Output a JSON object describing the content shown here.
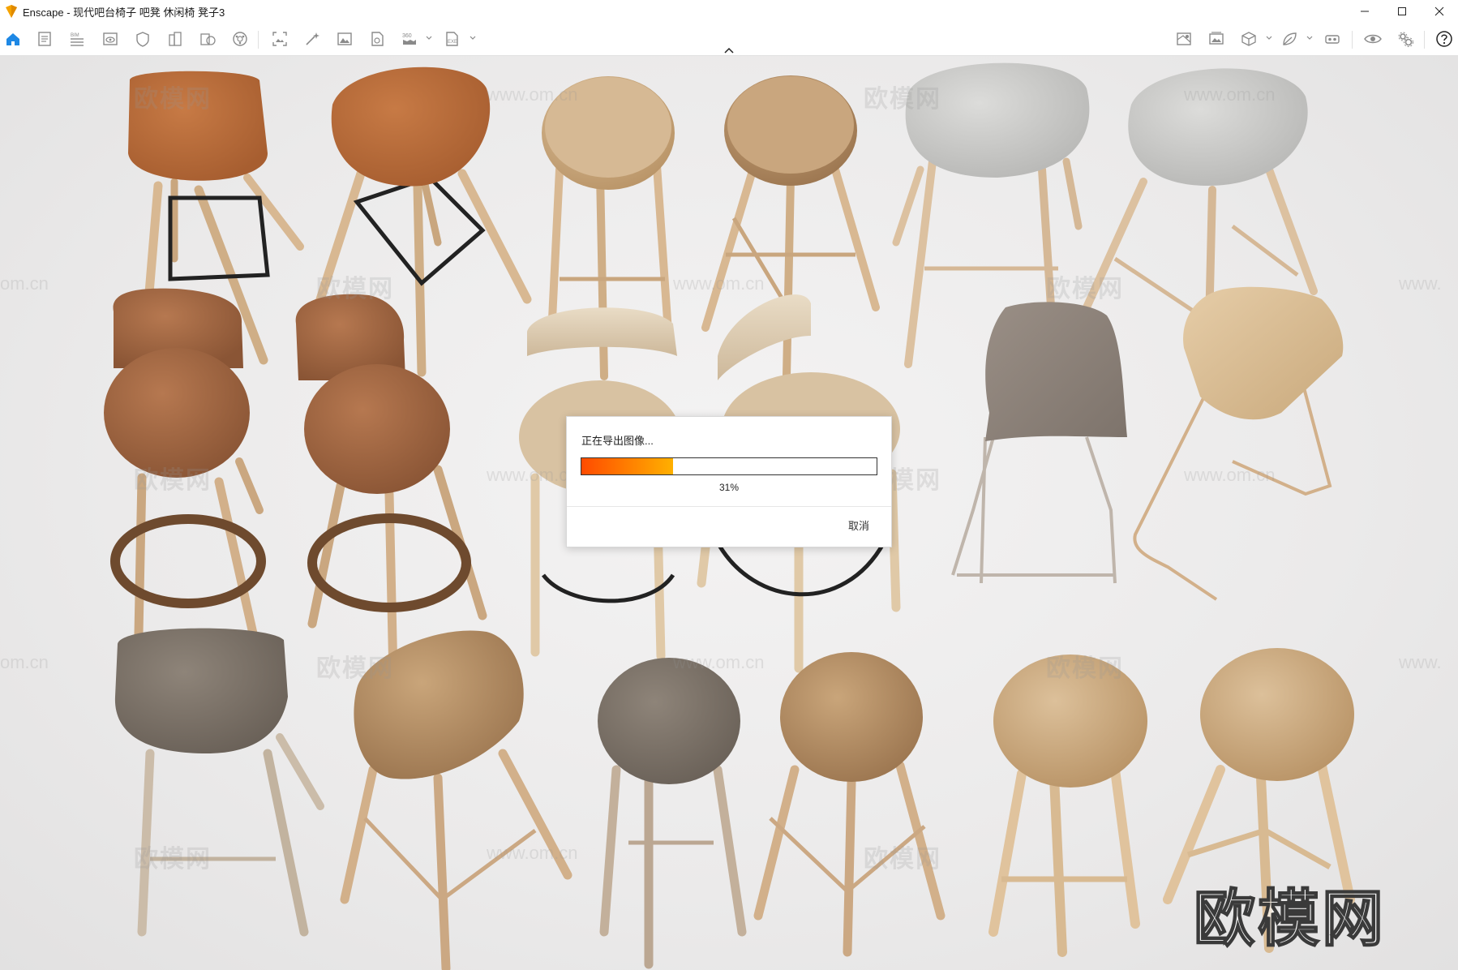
{
  "window": {
    "app_name": "Enscape",
    "title": "Enscape - 现代吧台椅子 吧凳 休闲椅 凳子3",
    "controls": [
      "minimize",
      "maximize",
      "close"
    ]
  },
  "toolbar": {
    "left_icons": [
      "home-icon",
      "notes-icon",
      "bim-icon",
      "visibility-icon",
      "safe-frame-icon",
      "building-icon",
      "asset-library-icon",
      "material-icon",
      "screenshot-icon",
      "sparkle-icon",
      "image-icon",
      "export-file-icon",
      "panorama-icon",
      "exe-export-icon"
    ],
    "right_icons": [
      "map-icon",
      "gallery-icon",
      "cube-icon",
      "leaf-icon",
      "vr-headset-icon",
      "eye-icon",
      "settings-icon",
      "help-icon"
    ]
  },
  "viewport": {
    "watermark_text": "欧模网",
    "watermark_url": "www.om.cn",
    "watermark_fragment_left": "om.cn",
    "watermark_fragment_right": "www."
  },
  "dialog": {
    "title": "正在导出图像...",
    "progress_percent": 31,
    "progress_label": "31%",
    "cancel_label": "取消"
  },
  "colors": {
    "accent": "#1e88e5",
    "progress_start": "#ff4b00",
    "progress_end": "#ffb000"
  }
}
